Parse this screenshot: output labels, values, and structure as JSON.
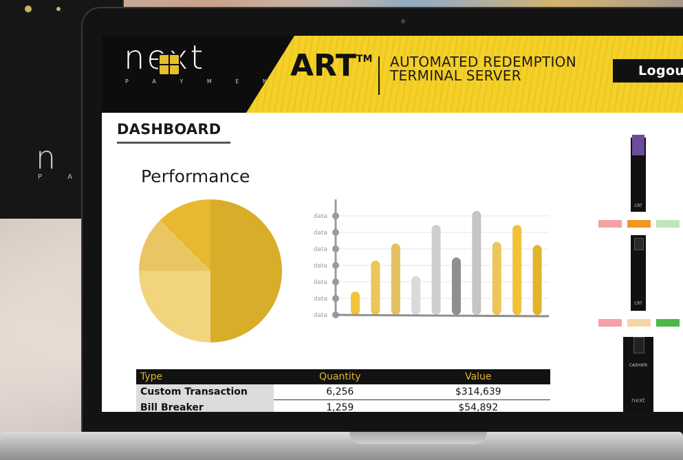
{
  "background": {
    "kiosk_logo": "n",
    "kiosk_sub": "P A Y"
  },
  "brand": {
    "logo": "next",
    "tagline": "P A Y M E N T S"
  },
  "header": {
    "title": "ART",
    "trademark": "TM",
    "subtitle_line1": "AUTOMATED REDEMPTION",
    "subtitle_line2": "TERMINAL SERVER",
    "logout_label": "Logout"
  },
  "page": {
    "title": "DASHBOARD",
    "section_title": "Performance"
  },
  "colors": {
    "gold": "#e8b830",
    "dark": "#0d0d0d",
    "yellow": "#f2cc22",
    "swatch_pink": "#f4a1a6",
    "swatch_orange": "#ef9722",
    "swatch_mint": "#bde6bd",
    "swatch_peach": "#f6d6a7",
    "swatch_green": "#4bb848"
  },
  "chart_data": [
    {
      "type": "pie",
      "slices": [
        {
          "value": 50,
          "color": "#d8ad2a"
        },
        {
          "value": 25,
          "color": "#f2d37e"
        },
        {
          "value": 12.5,
          "color": "#eac563"
        },
        {
          "value": 12.5,
          "color": "#e8b92f"
        }
      ]
    },
    {
      "type": "bar",
      "tick_labels": [
        "data",
        "data",
        "data",
        "data",
        "data",
        "data",
        "data"
      ],
      "values": [
        1.5,
        3.5,
        4.6,
        2.5,
        5.8,
        3.7,
        6.7,
        4.7,
        5.8,
        4.5
      ],
      "colors": [
        "#f2c33b",
        "#ecc65a",
        "#e5c060",
        "#d9d9d9",
        "#cfcfcf",
        "#8f8f8f",
        "#c5c5c5",
        "#ecc65a",
        "#efc23a",
        "#e1b42b"
      ],
      "ylim": [
        0,
        7
      ]
    }
  ],
  "table": {
    "headers": [
      "Type",
      "Quantity",
      "Value"
    ],
    "rows": [
      [
        "Custom Transaction",
        "6,256",
        "$314,639"
      ],
      [
        "Bill Breaker",
        "1,259",
        "$54,892"
      ]
    ]
  },
  "kiosks": [
    {
      "label": "CRT"
    },
    {
      "label": "CRT"
    },
    {
      "label": "CASHIER",
      "logo": "next"
    }
  ]
}
